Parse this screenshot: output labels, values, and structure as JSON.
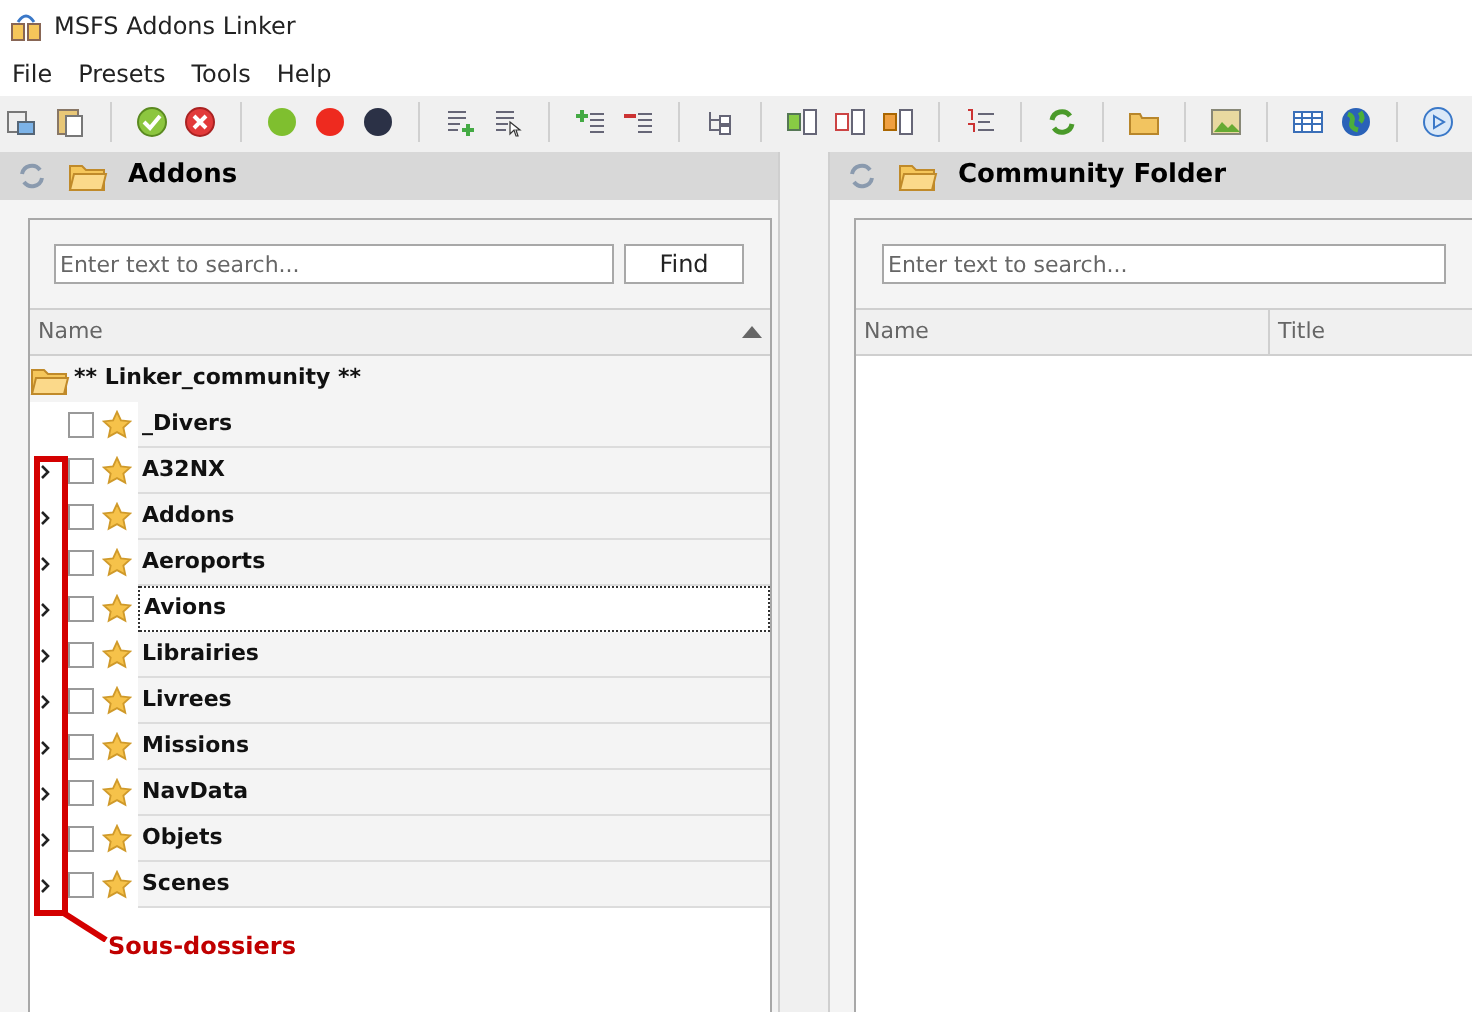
{
  "window": {
    "title": "MSFS Addons Linker"
  },
  "menu": [
    "File",
    "Presets",
    "Tools",
    "Help"
  ],
  "left_panel": {
    "title": "Addons",
    "search": {
      "placeholder": "Enter text to search..."
    },
    "find_button": "Find",
    "columns": [
      "Name"
    ],
    "tree": {
      "label": "** Linker_community **",
      "expanded": true,
      "children": [
        {
          "label": "_Divers",
          "expandable": false,
          "checked": false,
          "focused": false
        },
        {
          "label": "A32NX",
          "expandable": true,
          "checked": false,
          "focused": false
        },
        {
          "label": "Addons",
          "expandable": true,
          "checked": false,
          "focused": false
        },
        {
          "label": "Aeroports",
          "expandable": true,
          "checked": false,
          "focused": false
        },
        {
          "label": "Avions",
          "expandable": true,
          "checked": false,
          "focused": true
        },
        {
          "label": "Librairies",
          "expandable": true,
          "checked": false,
          "focused": false
        },
        {
          "label": "Livrees",
          "expandable": true,
          "checked": false,
          "focused": false
        },
        {
          "label": "Missions",
          "expandable": true,
          "checked": false,
          "focused": false
        },
        {
          "label": "NavData",
          "expandable": true,
          "checked": false,
          "focused": false
        },
        {
          "label": "Objets",
          "expandable": true,
          "checked": false,
          "focused": false
        },
        {
          "label": "Scenes",
          "expandable": true,
          "checked": false,
          "focused": false
        }
      ]
    }
  },
  "right_panel": {
    "title": "Community Folder",
    "search": {
      "placeholder": "Enter text to search..."
    },
    "columns": [
      "Name",
      "Title"
    ]
  },
  "annotation": {
    "label": "Sous-dossiers"
  }
}
